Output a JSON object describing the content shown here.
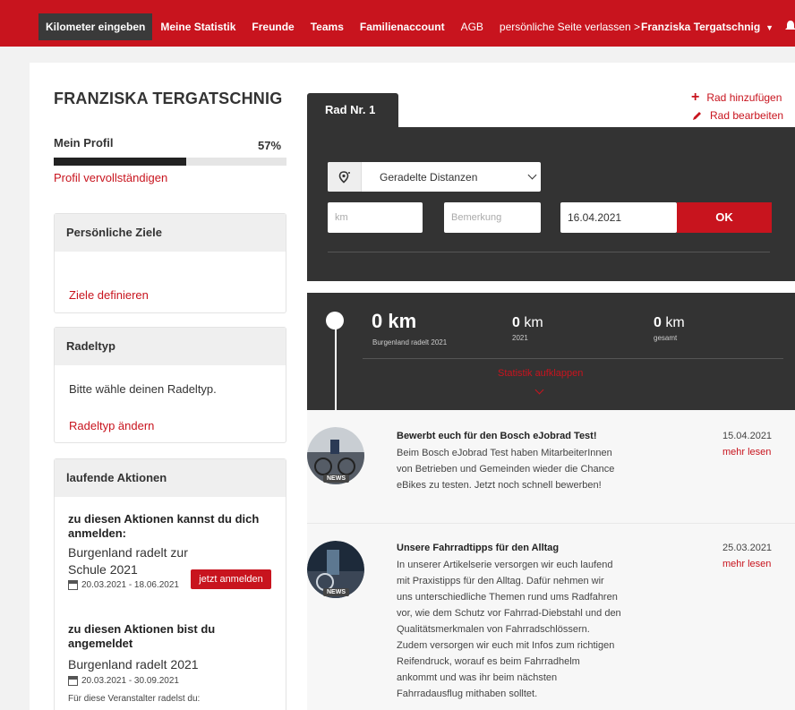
{
  "nav": {
    "items": [
      {
        "label": "Kilometer eingeben",
        "active": true
      },
      {
        "label": "Meine Statistik"
      },
      {
        "label": "Freunde"
      },
      {
        "label": "Teams"
      },
      {
        "label": "Familienaccount"
      },
      {
        "label": "AGB",
        "normal": true
      },
      {
        "label": "persönliche Seite verlassen >",
        "normal": true
      }
    ],
    "user": "Franziska Tergatschnig",
    "colors": {
      "brand": "#c8141e",
      "active": "#3a3a3a"
    }
  },
  "profile": {
    "name": "FRANZISKA TERGATSCHNIG",
    "label": "Mein Profil",
    "percent_text": "57%",
    "percent": 0.57,
    "link": "Profil vervollständigen"
  },
  "goals": {
    "heading": "Persönliche Ziele",
    "link": "Ziele definieren"
  },
  "rider_type": {
    "heading": "Radeltyp",
    "text": "Bitte wähle deinen Radeltyp.",
    "link": "Radeltyp ändern"
  },
  "actions": {
    "heading": "laufende Aktionen",
    "signup_heading": "zu diesen Aktionen kannst du dich anmelden:",
    "signup_title_1": "Burgenland radelt zur",
    "signup_title_2": "Schule 2021",
    "signup_date": "20.03.2021 - 18.06.2021",
    "signup_button": "jetzt anmelden",
    "registered_heading": "zu diesen Aktionen bist du angemeldet",
    "registered_title": "Burgenland radelt 2021",
    "registered_date": "20.03.2021 - 30.09.2021",
    "registered_note": "Für diese Veranstalter radelst du:"
  },
  "bike": {
    "tab": "Rad Nr. 1",
    "add": "Rad hinzufügen",
    "edit": "Rad bearbeiten",
    "select_value": "Geradelte Distanzen",
    "km_placeholder": "km",
    "note_placeholder": "Bemerkung",
    "date_value": "16.04.2021",
    "ok": "OK"
  },
  "stats": {
    "main_value": "0 km",
    "main_sub": "Burgenland radelt 2021",
    "year_value": "0",
    "year_unit": " km",
    "year_sub": "2021",
    "total_value": "0",
    "total_unit": " km",
    "total_sub": "gesamt",
    "toggle": "Statistik aufklappen"
  },
  "news": [
    {
      "title": "Bewerbt euch für den Bosch eJobrad Test!",
      "lines": [
        "Beim Bosch eJobrad Test haben MitarbeiterInnen",
        "von Betrieben und Gemeinden wieder die Chance",
        "eBikes zu testen. Jetzt noch schnell bewerben!"
      ],
      "date": "15.04.2021",
      "more": "mehr lesen",
      "badge": "NEWS"
    },
    {
      "title": "Unsere Fahrradtipps für den Alltag",
      "lines": [
        "In unserer Artikelserie versorgen wir euch laufend",
        "mit Praxistipps für den Alltag. Dafür nehmen wir",
        "uns unterschiedliche Themen rund ums Radfahren",
        "vor, wie dem Schutz vor Fahrrad-Diebstahl und den",
        "Qualitätsmerkmalen von Fahrradschlössern.",
        "Zudem versorgen wir euch mit Infos zum richtigen",
        "Reifendruck, worauf es beim Fahrradhelm",
        "ankommt und was ihr beim nächsten",
        "Fahrradausflug mithaben solltet."
      ],
      "date": "25.03.2021",
      "more": "mehr lesen",
      "badge": "NEWS"
    }
  ]
}
